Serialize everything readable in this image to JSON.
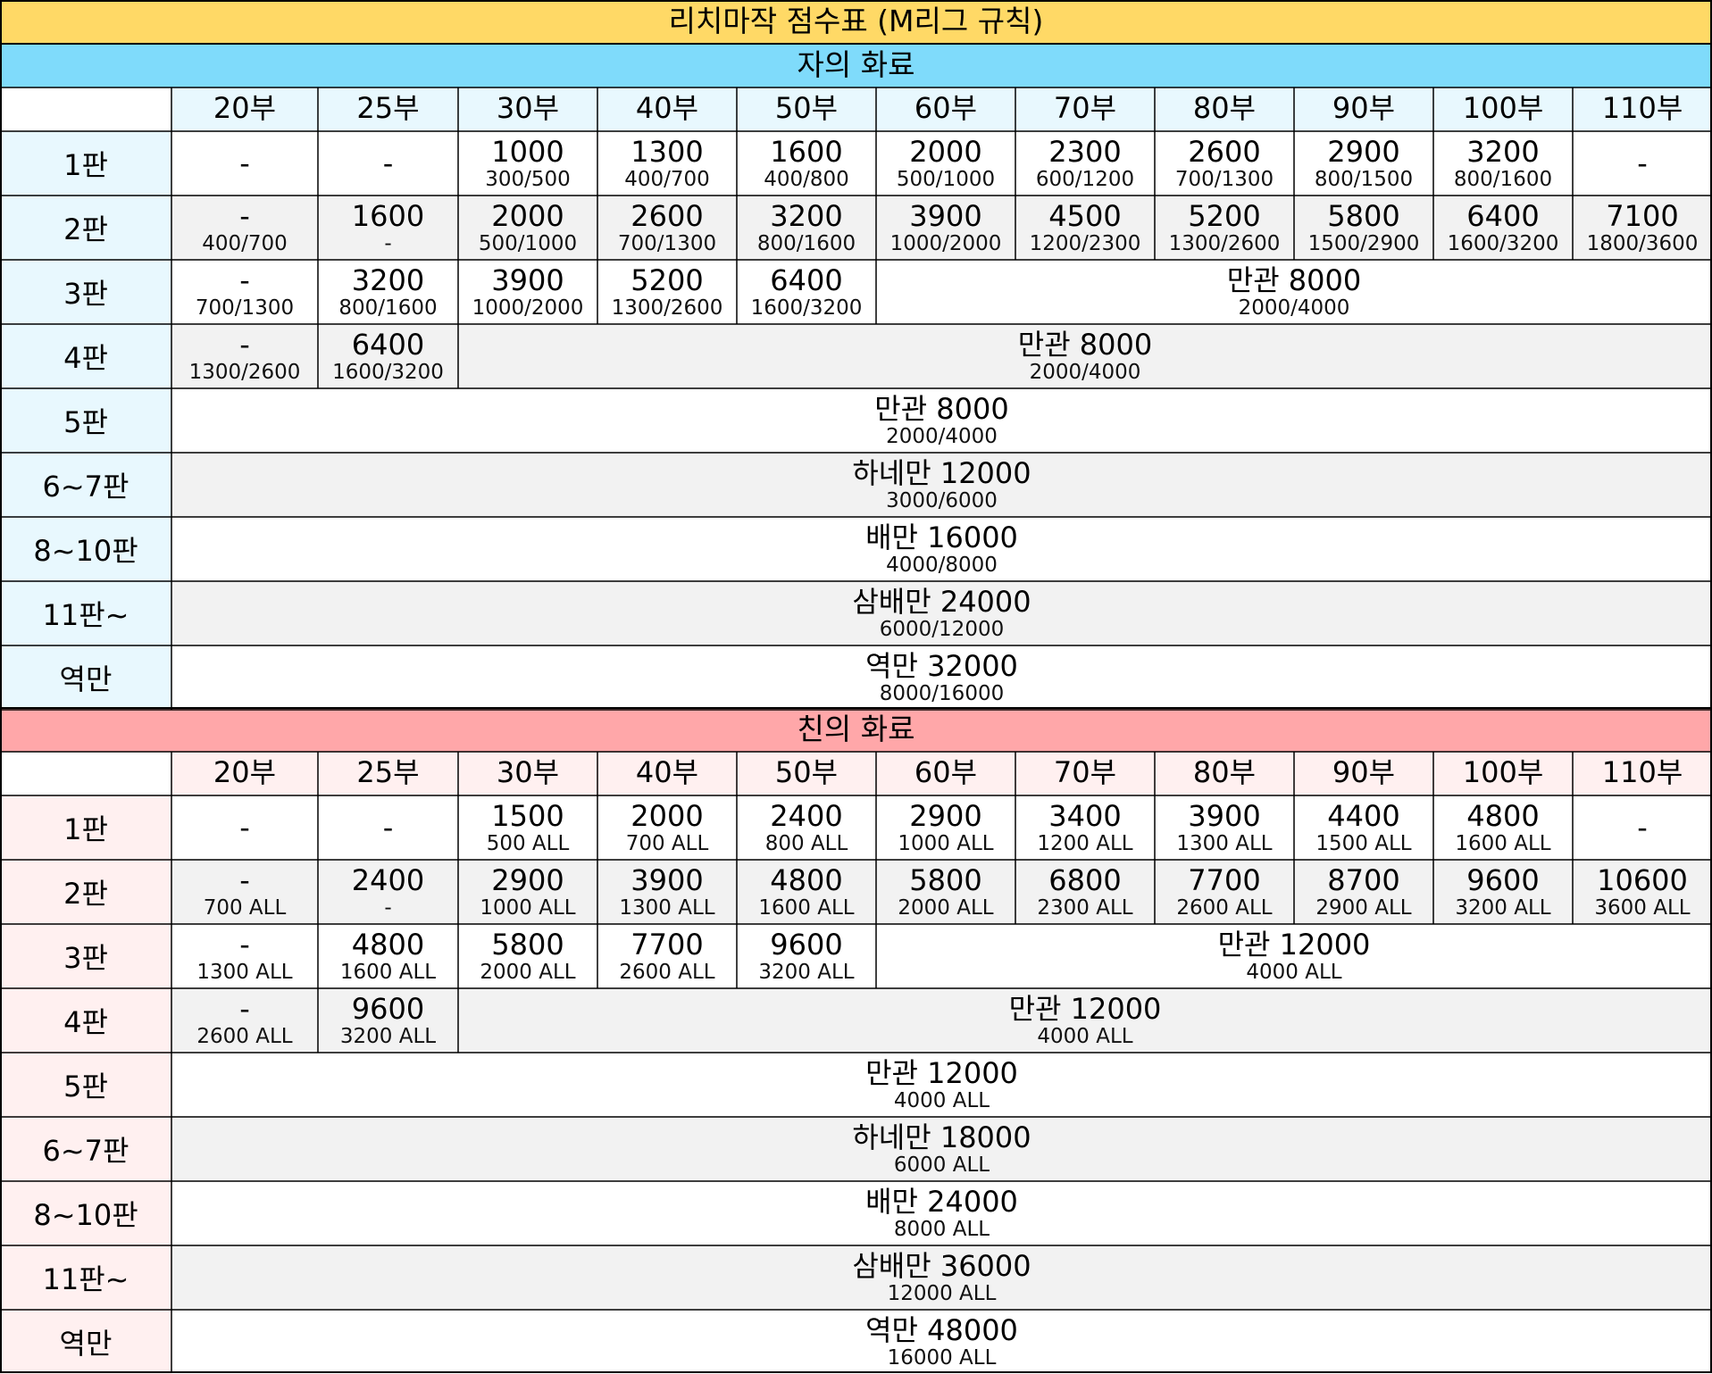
{
  "title": "리치마작 점수표 (M리그 규칙)",
  "colors": {
    "title_bg": "#ffd966",
    "ko_bg": "#7fdbfb",
    "ko_row_bg": "#e8f8fe",
    "oya_bg": "#ffa7a9",
    "oya_row_bg": "#fff0f0",
    "alt_bg": "#f2f2f2",
    "line": "#000000"
  },
  "fu_headers": [
    "20부",
    "25부",
    "30부",
    "40부",
    "50부",
    "60부",
    "70부",
    "80부",
    "90부",
    "100부",
    "110부"
  ],
  "sections": [
    {
      "key": "ko",
      "label": "자의 화료",
      "rows": [
        {
          "han": "1판",
          "cells": [
            {
              "main": "-",
              "sub": ""
            },
            {
              "main": "-",
              "sub": ""
            },
            {
              "main": "1000",
              "sub": "300/500"
            },
            {
              "main": "1300",
              "sub": "400/700"
            },
            {
              "main": "1600",
              "sub": "400/800"
            },
            {
              "main": "2000",
              "sub": "500/1000"
            },
            {
              "main": "2300",
              "sub": "600/1200"
            },
            {
              "main": "2600",
              "sub": "700/1300"
            },
            {
              "main": "2900",
              "sub": "800/1500"
            },
            {
              "main": "3200",
              "sub": "800/1600"
            },
            {
              "main": "-",
              "sub": ""
            }
          ]
        },
        {
          "han": "2판",
          "cells": [
            {
              "main": "-",
              "sub": "400/700"
            },
            {
              "main": "1600",
              "sub": "-"
            },
            {
              "main": "2000",
              "sub": "500/1000"
            },
            {
              "main": "2600",
              "sub": "700/1300"
            },
            {
              "main": "3200",
              "sub": "800/1600"
            },
            {
              "main": "3900",
              "sub": "1000/2000"
            },
            {
              "main": "4500",
              "sub": "1200/2300"
            },
            {
              "main": "5200",
              "sub": "1300/2600"
            },
            {
              "main": "5800",
              "sub": "1500/2900"
            },
            {
              "main": "6400",
              "sub": "1600/3200"
            },
            {
              "main": "7100",
              "sub": "1800/3600"
            }
          ]
        },
        {
          "han": "3판",
          "cells": [
            {
              "main": "-",
              "sub": "700/1300"
            },
            {
              "main": "3200",
              "sub": "800/1600"
            },
            {
              "main": "3900",
              "sub": "1000/2000"
            },
            {
              "main": "5200",
              "sub": "1300/2600"
            },
            {
              "main": "6400",
              "sub": "1600/3200"
            }
          ],
          "merged": {
            "main": "만관 8000",
            "sub": "2000/4000"
          }
        },
        {
          "han": "4판",
          "cells": [
            {
              "main": "-",
              "sub": "1300/2600"
            },
            {
              "main": "6400",
              "sub": "1600/3200"
            }
          ],
          "merged": {
            "main": "만관 8000",
            "sub": "2000/4000"
          }
        },
        {
          "han": "5판",
          "cells": [],
          "merged": {
            "main": "만관 8000",
            "sub": "2000/4000"
          }
        },
        {
          "han": "6~7판",
          "cells": [],
          "merged": {
            "main": "하네만 12000",
            "sub": "3000/6000"
          }
        },
        {
          "han": "8~10판",
          "cells": [],
          "merged": {
            "main": "배만 16000",
            "sub": "4000/8000"
          }
        },
        {
          "han": "11판~",
          "cells": [],
          "merged": {
            "main": "삼배만 24000",
            "sub": "6000/12000"
          }
        },
        {
          "han": "역만",
          "cells": [],
          "merged": {
            "main": "역만 32000",
            "sub": "8000/16000"
          }
        }
      ]
    },
    {
      "key": "oya",
      "label": "친의 화료",
      "rows": [
        {
          "han": "1판",
          "cells": [
            {
              "main": "-",
              "sub": ""
            },
            {
              "main": "-",
              "sub": ""
            },
            {
              "main": "1500",
              "sub": "500 ALL"
            },
            {
              "main": "2000",
              "sub": "700 ALL"
            },
            {
              "main": "2400",
              "sub": "800 ALL"
            },
            {
              "main": "2900",
              "sub": "1000 ALL"
            },
            {
              "main": "3400",
              "sub": "1200 ALL"
            },
            {
              "main": "3900",
              "sub": "1300 ALL"
            },
            {
              "main": "4400",
              "sub": "1500 ALL"
            },
            {
              "main": "4800",
              "sub": "1600 ALL"
            },
            {
              "main": "-",
              "sub": ""
            }
          ]
        },
        {
          "han": "2판",
          "cells": [
            {
              "main": "-",
              "sub": "700 ALL"
            },
            {
              "main": "2400",
              "sub": "-"
            },
            {
              "main": "2900",
              "sub": "1000 ALL"
            },
            {
              "main": "3900",
              "sub": "1300 ALL"
            },
            {
              "main": "4800",
              "sub": "1600 ALL"
            },
            {
              "main": "5800",
              "sub": "2000 ALL"
            },
            {
              "main": "6800",
              "sub": "2300 ALL"
            },
            {
              "main": "7700",
              "sub": "2600 ALL"
            },
            {
              "main": "8700",
              "sub": "2900 ALL"
            },
            {
              "main": "9600",
              "sub": "3200 ALL"
            },
            {
              "main": "10600",
              "sub": "3600 ALL"
            }
          ]
        },
        {
          "han": "3판",
          "cells": [
            {
              "main": "-",
              "sub": "1300 ALL"
            },
            {
              "main": "4800",
              "sub": "1600 ALL"
            },
            {
              "main": "5800",
              "sub": "2000 ALL"
            },
            {
              "main": "7700",
              "sub": "2600 ALL"
            },
            {
              "main": "9600",
              "sub": "3200 ALL"
            }
          ],
          "merged": {
            "main": "만관 12000",
            "sub": "4000 ALL"
          }
        },
        {
          "han": "4판",
          "cells": [
            {
              "main": "-",
              "sub": "2600 ALL"
            },
            {
              "main": "9600",
              "sub": "3200 ALL"
            }
          ],
          "merged": {
            "main": "만관 12000",
            "sub": "4000 ALL"
          }
        },
        {
          "han": "5판",
          "cells": [],
          "merged": {
            "main": "만관 12000",
            "sub": "4000 ALL"
          }
        },
        {
          "han": "6~7판",
          "cells": [],
          "merged": {
            "main": "하네만 18000",
            "sub": "6000 ALL"
          }
        },
        {
          "han": "8~10판",
          "cells": [],
          "merged": {
            "main": "배만 24000",
            "sub": "8000 ALL"
          }
        },
        {
          "han": "11판~",
          "cells": [],
          "merged": {
            "main": "삼배만 36000",
            "sub": "12000 ALL"
          }
        },
        {
          "han": "역만",
          "cells": [],
          "merged": {
            "main": "역만 48000",
            "sub": "16000 ALL"
          }
        }
      ]
    }
  ]
}
